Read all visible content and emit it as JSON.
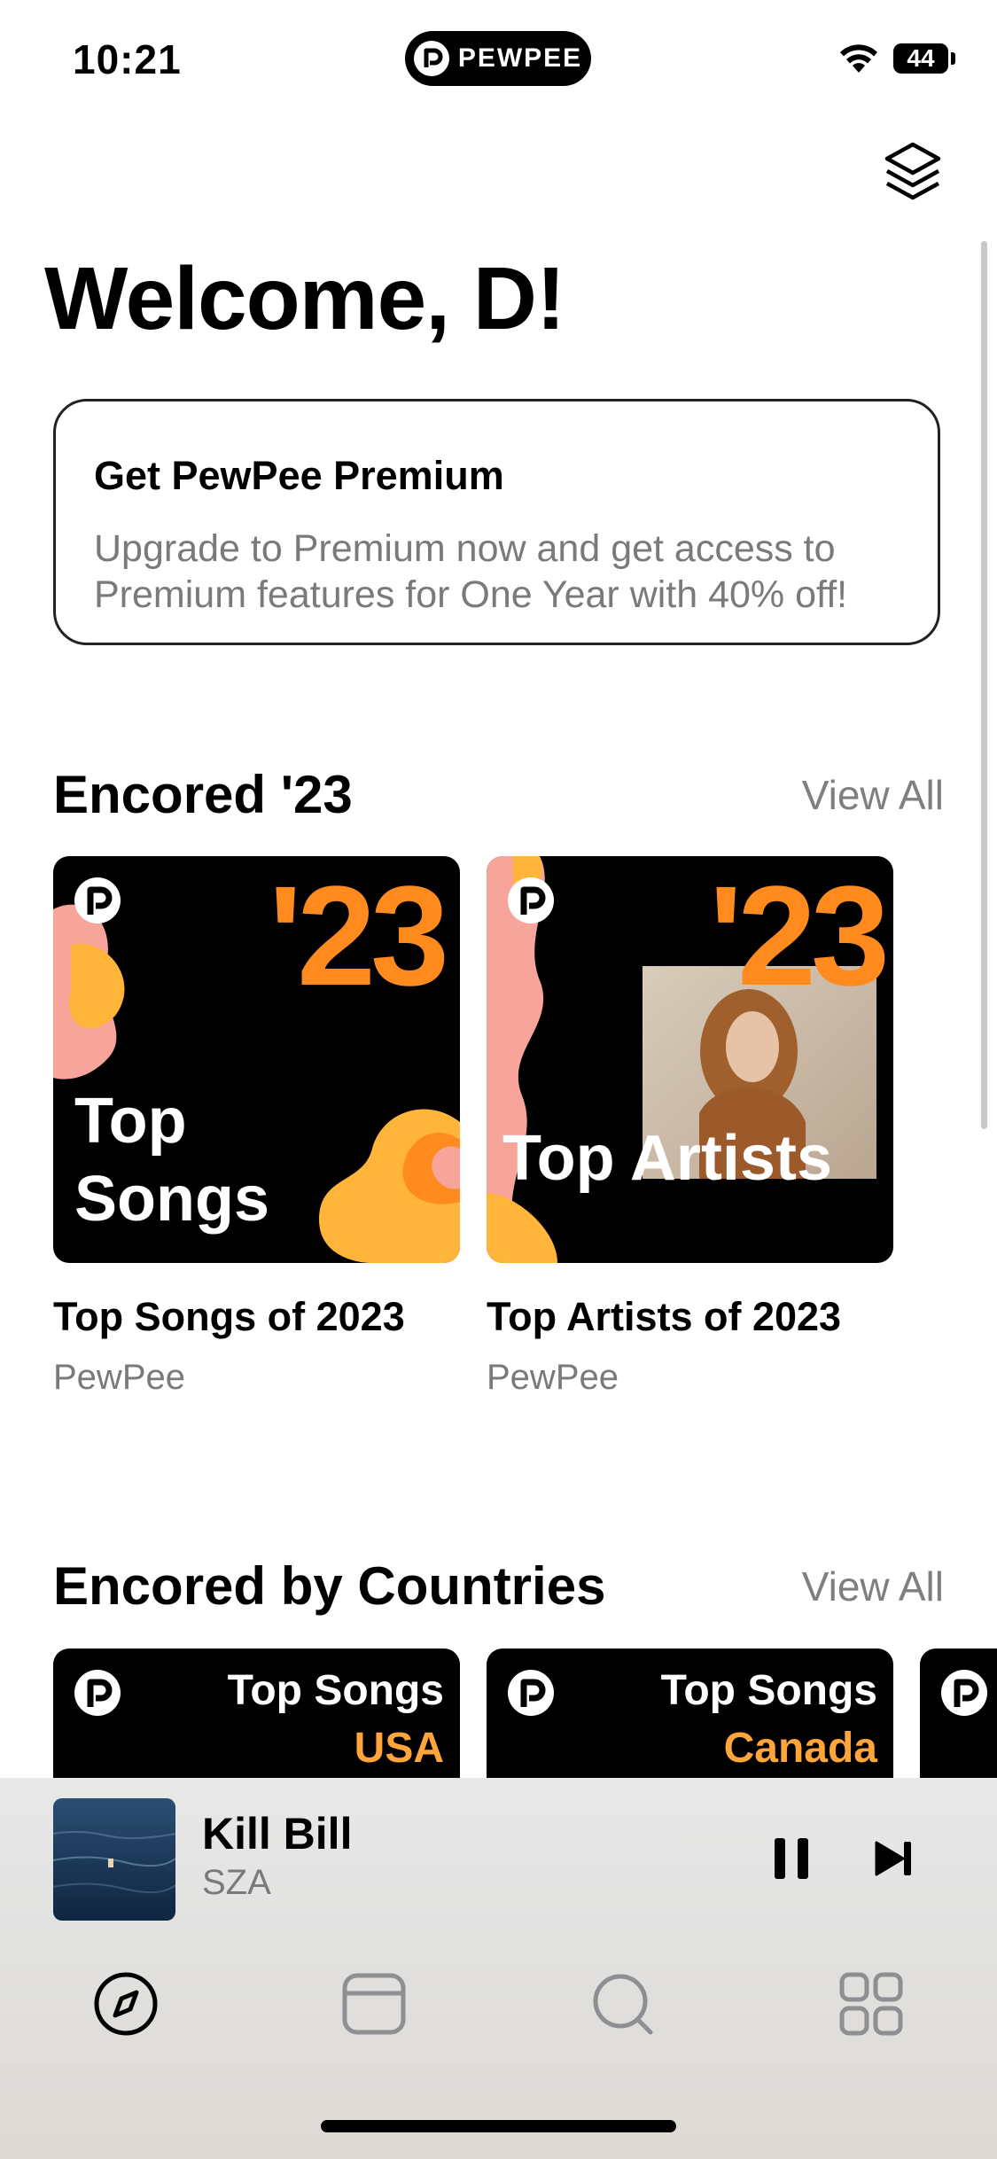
{
  "status_bar": {
    "time": "10:21",
    "island_label": "PEWPEE",
    "battery": "44"
  },
  "page": {
    "welcome": "Welcome, D!"
  },
  "premium_card": {
    "title": "Get PewPee Premium",
    "description": "Upgrade to Premium now and get access to Premium features for One Year with 40% off!"
  },
  "encored_23": {
    "title": "Encored '23",
    "view_all": "View All",
    "items": [
      {
        "art_year": "'23",
        "art_label_line1": "Top",
        "art_label_line2": "Songs",
        "caption": "Top Songs of 2023",
        "subtitle": "PewPee"
      },
      {
        "art_year": "'23",
        "art_label_line1": "Top Artists",
        "caption": "Top Artists of 2023",
        "subtitle": "PewPee"
      }
    ]
  },
  "encored_countries": {
    "title": "Encored by Countries",
    "view_all": "View All",
    "items": [
      {
        "label": "Top Songs",
        "country": "USA"
      },
      {
        "label": "Top Songs",
        "country": "Canada"
      }
    ]
  },
  "now_playing": {
    "title": "Kill Bill",
    "artist": "SZA"
  },
  "tab_bar": {
    "tabs": [
      {
        "icon": "compass-icon",
        "active": true
      },
      {
        "icon": "library-icon",
        "active": false
      },
      {
        "icon": "search-icon",
        "active": false
      },
      {
        "icon": "grid-icon",
        "active": false
      }
    ]
  },
  "colors": {
    "accent_orange": "#ff8a1e",
    "accent_pink": "#f7a59a",
    "accent_yellow": "#ffb53a",
    "muted_text": "#7a7a7a"
  }
}
